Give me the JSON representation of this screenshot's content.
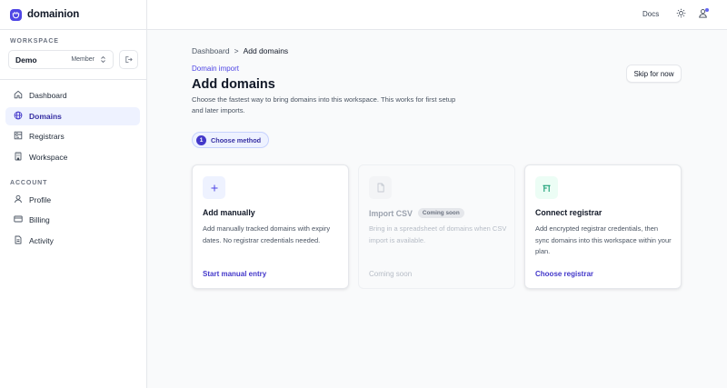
{
  "brand": {
    "name": "domainion",
    "accent": "#4f46e5"
  },
  "sidebar": {
    "workspace_label": "WORKSPACE",
    "workspace": {
      "name": "Demo",
      "role": "Member"
    },
    "nav": [
      {
        "label": "Dashboard",
        "icon": "home-icon"
      },
      {
        "label": "Domains",
        "icon": "globe-icon",
        "active": true
      },
      {
        "label": "Registrars",
        "icon": "server-icon"
      },
      {
        "label": "Workspace",
        "icon": "building-icon"
      }
    ],
    "account_label": "ACCOUNT",
    "account": [
      {
        "label": "Profile",
        "icon": "user-icon"
      },
      {
        "label": "Billing",
        "icon": "credit-card-icon"
      },
      {
        "label": "Activity",
        "icon": "document-icon"
      }
    ]
  },
  "topbar": {
    "docs_label": "Docs"
  },
  "breadcrumb": {
    "parent": "Dashboard",
    "separator": ">",
    "current": "Add domains"
  },
  "header": {
    "eyebrow": "Domain import",
    "title": "Add domains",
    "description": "Choose the fastest way to bring domains into this workspace. This works for first setup and later imports.",
    "skip_label": "Skip for now"
  },
  "step": {
    "number": "1",
    "label": "Choose method"
  },
  "cards": [
    {
      "title": "Add manually",
      "description": "Add manually tracked domains with expiry dates. No registrar credentials needed.",
      "action": "Start manual entry",
      "icon": "plus-icon",
      "enabled": true
    },
    {
      "title": "Import CSV",
      "badge": "Coming soon",
      "description": "Bring in a spreadsheet of domains when CSV import is available.",
      "action": "Coming soon",
      "icon": "file-icon",
      "enabled": false
    },
    {
      "title": "Connect registrar",
      "description": "Add encrypted registrar credentials, then sync domains into this workspace within your plan.",
      "action": "Choose registrar",
      "icon": "registrar-icon",
      "enabled": true
    }
  ]
}
